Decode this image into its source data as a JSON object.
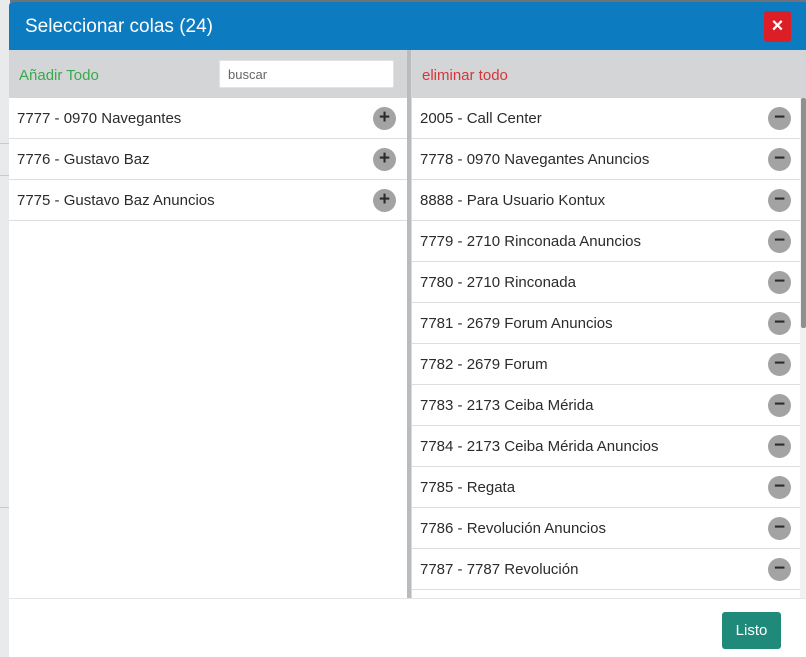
{
  "modal": {
    "title": "Seleccionar colas (24)",
    "close_label": "×"
  },
  "left_pane": {
    "add_all_label": "Añadir Todo",
    "search": {
      "placeholder": "buscar",
      "value": ""
    },
    "items": [
      {
        "label": "7777 - 0970 Navegantes",
        "action": "+"
      },
      {
        "label": "7776 - Gustavo Baz",
        "action": "+"
      },
      {
        "label": "7775 - Gustavo Baz Anuncios",
        "action": "+"
      }
    ]
  },
  "right_pane": {
    "remove_all_label": "eliminar todo",
    "items": [
      {
        "label": "2005 - Call Center",
        "action": "−"
      },
      {
        "label": "7778 - 0970 Navegantes Anuncios",
        "action": "−"
      },
      {
        "label": "8888 - Para Usuario Kontux",
        "action": "−"
      },
      {
        "label": "7779 - 2710 Rinconada Anuncios",
        "action": "−"
      },
      {
        "label": "7780 - 2710 Rinconada",
        "action": "−"
      },
      {
        "label": "7781 - 2679 Forum Anuncios",
        "action": "−"
      },
      {
        "label": "7782 - 2679 Forum",
        "action": "−"
      },
      {
        "label": "7783 - 2173 Ceiba Mérida",
        "action": "−"
      },
      {
        "label": "7784 - 2173 Ceiba Mérida Anuncios",
        "action": "−"
      },
      {
        "label": "7785 - Regata",
        "action": "−"
      },
      {
        "label": "7786 - Revolución Anuncios",
        "action": "−"
      },
      {
        "label": "7787 - 7787 Revolución",
        "action": "−"
      }
    ]
  },
  "footer": {
    "done_label": "Listo"
  },
  "colors": {
    "header": "#0d7bc0",
    "close": "#dc1f26",
    "add_all": "#3aa94e",
    "remove_all": "#d8343a",
    "done": "#208a7a"
  }
}
